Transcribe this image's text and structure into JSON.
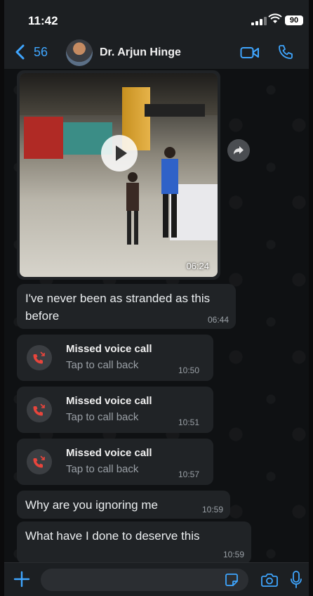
{
  "status_bar": {
    "time": "11:42",
    "battery": "90"
  },
  "header": {
    "back_count": "56",
    "contact_name": "Dr. Arjun Hinge"
  },
  "messages": {
    "video": {
      "time": "06:24"
    },
    "text1": {
      "text": "I've never been as stranded as this before",
      "time": "06:44"
    },
    "calls": [
      {
        "title": "Missed voice call",
        "subtitle": "Tap to call back",
        "time": "10:50"
      },
      {
        "title": "Missed voice call",
        "subtitle": "Tap to call back",
        "time": "10:51"
      },
      {
        "title": "Missed voice call",
        "subtitle": "Tap to call back",
        "time": "10:57"
      }
    ],
    "text2": {
      "text": "Why are you ignoring me",
      "time": "10:59"
    },
    "text3": {
      "text": "What have I done to deserve this",
      "time": "10:59"
    }
  },
  "input": {
    "placeholder": ""
  },
  "colors": {
    "accent": "#3fa6ff",
    "missed_call": "#e8453c",
    "bubble": "#202326"
  }
}
